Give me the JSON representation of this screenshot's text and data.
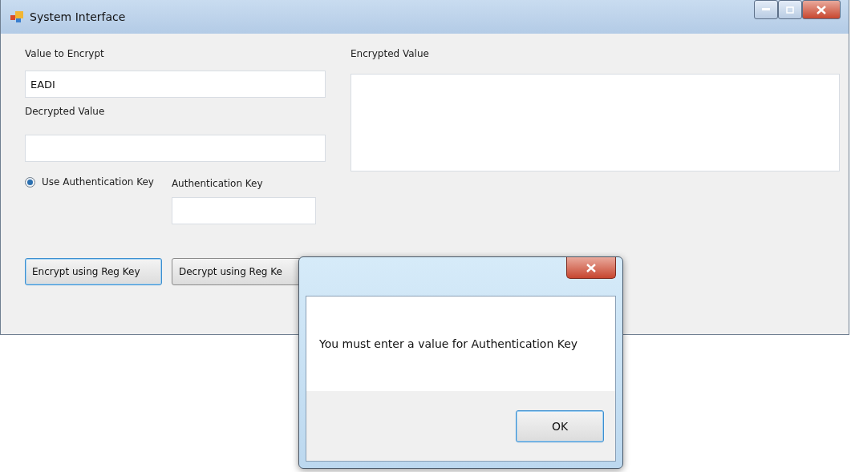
{
  "window": {
    "title": "System Interface"
  },
  "value_to_encrypt": {
    "label": "Value to Encrypt",
    "value": "EADI"
  },
  "decrypted_value": {
    "label": "Decrypted Value"
  },
  "encrypted_value": {
    "label": "Encrypted Value"
  },
  "use_authentication_key": {
    "label": "Use Authentication Key",
    "selected": true
  },
  "authentication_key": {
    "label": "Authentication Key"
  },
  "buttons": [
    {
      "label": "Encrypt using Reg Key",
      "focused": true
    },
    {
      "label": "Decrypt using Reg Ke",
      "focused": false
    }
  ],
  "dialog": {
    "message": "You must enter a value for Authentication Key",
    "button": "OK"
  }
}
